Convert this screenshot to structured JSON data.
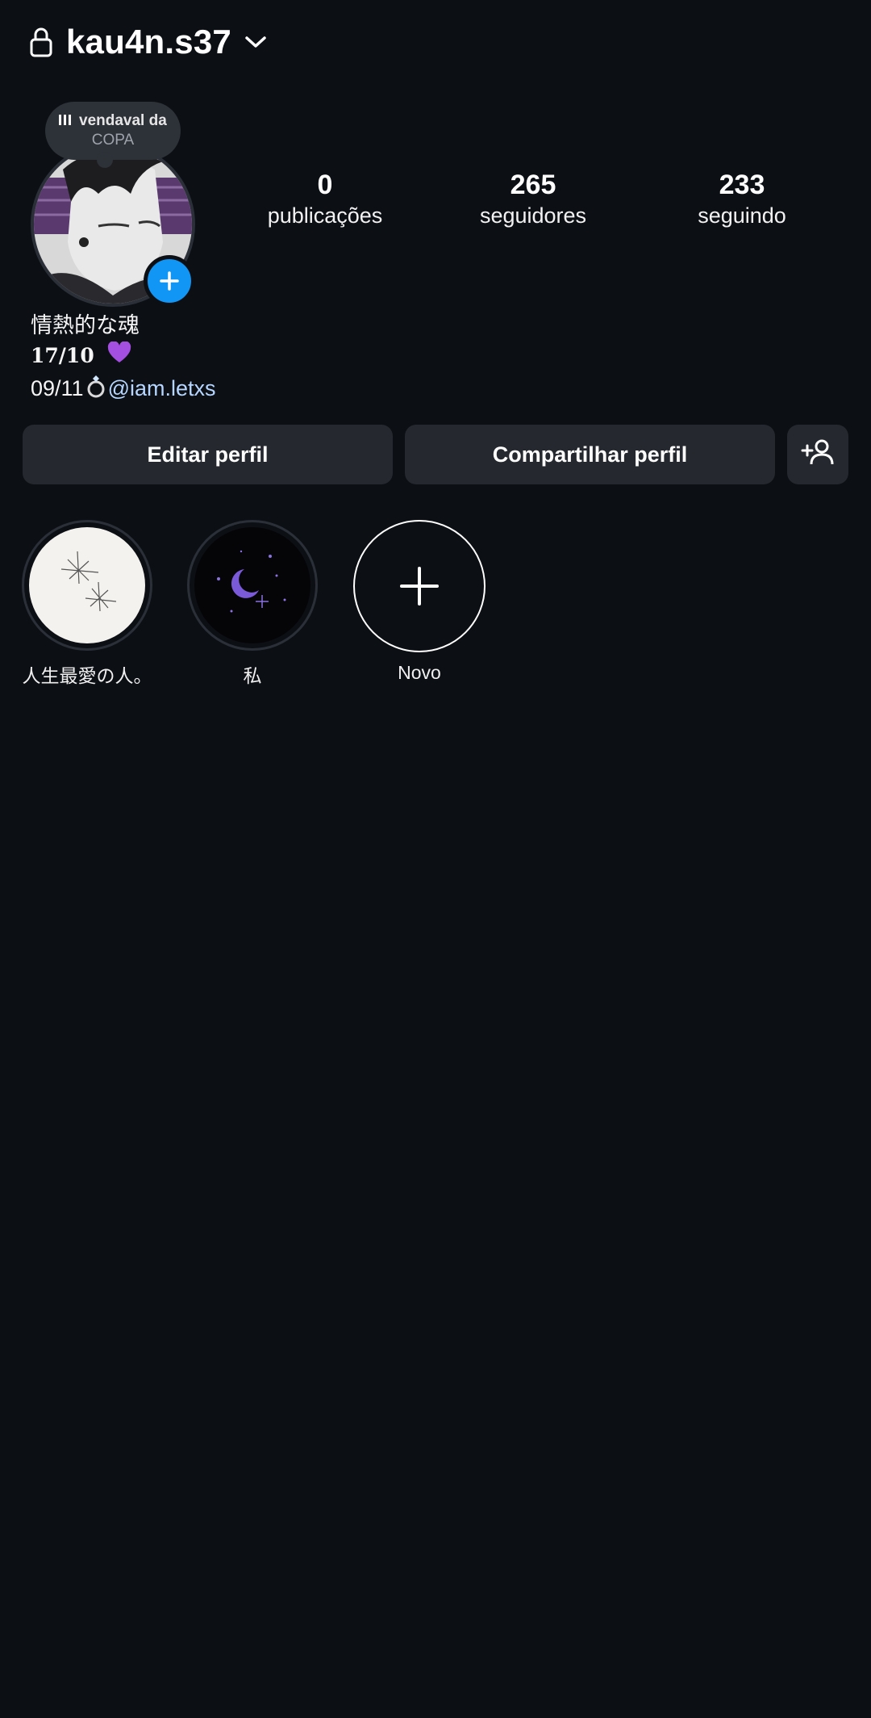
{
  "header": {
    "username": "kau4n.s37",
    "lock_icon": "lock-icon",
    "chevron_icon": "chevron-down-icon"
  },
  "note": {
    "song_title": "vendaval da",
    "artist": "COPA",
    "bars_icon": "equalizer-bars-icon"
  },
  "stats": [
    {
      "value": "0",
      "label": "publicações"
    },
    {
      "value": "265",
      "label": "seguidores"
    },
    {
      "value": "233",
      "label": "seguindo"
    }
  ],
  "bio": {
    "line1": "情熱的な魂",
    "line2": "17/10",
    "line3_prefix": "09/11",
    "mention": "@iam.letxs"
  },
  "buttons": {
    "edit": "Editar perfil",
    "share": "Compartilhar perfil",
    "add_person_icon": "add-person-icon"
  },
  "highlights": [
    {
      "label": "人生最愛の人。"
    },
    {
      "label": "私"
    },
    {
      "label": "Novo"
    }
  ],
  "colors": {
    "background": "#0c0f14",
    "button": "#25292f",
    "accent_blue": "#1196f5",
    "mention": "#b6d6ff",
    "heart": "#a44fe0"
  }
}
